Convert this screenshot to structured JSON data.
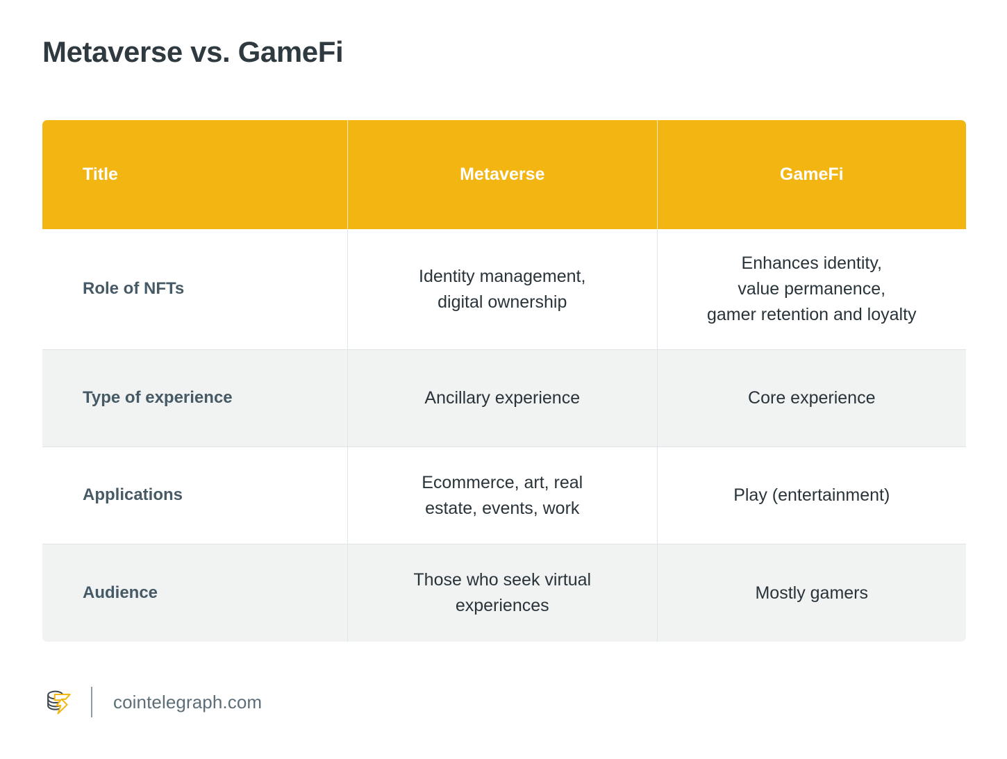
{
  "page": {
    "title": "Metaverse vs. GameFi",
    "background_color": "#ffffff"
  },
  "colors": {
    "header_amber": "#f3b511",
    "row_gray": "#f1f2f2",
    "row_white": "#ffffff",
    "border": "#dfe4e8",
    "label_text": "#465a66",
    "value_text": "#29343a",
    "title_text": "#2e3a40",
    "footer_text": "#5d6e79",
    "logo_gold": "#f3b511",
    "logo_dark": "#3c474d"
  },
  "table": {
    "columns": [
      {
        "key": "title",
        "header": "Title",
        "align": "left"
      },
      {
        "key": "metaverse",
        "header": "Metaverse",
        "align": "center"
      },
      {
        "key": "gamefi",
        "header": "GameFi",
        "align": "center"
      }
    ],
    "rows": [
      {
        "label": "Role of NFTs",
        "metaverse": [
          "Identity management,",
          "digital ownership"
        ],
        "gamefi": [
          "Enhances identity,",
          "value permanence,",
          "gamer retention and loyalty"
        ],
        "shade": "white"
      },
      {
        "label": "Type of experience",
        "metaverse": [
          "Ancillary experience"
        ],
        "gamefi": [
          "Core experience"
        ],
        "shade": "gray"
      },
      {
        "label": "Applications",
        "metaverse": [
          "Ecommerce, art, real",
          "estate, events, work"
        ],
        "gamefi": [
          "Play (entertainment)"
        ],
        "shade": "white"
      },
      {
        "label": "Audience",
        "metaverse": [
          "Those who seek virtual",
          "experiences"
        ],
        "gamefi": [
          "Mostly gamers"
        ],
        "shade": "gray"
      }
    ]
  },
  "footer": {
    "logo_name": "cointelegraph-logo-icon",
    "site": "cointelegraph.com"
  }
}
